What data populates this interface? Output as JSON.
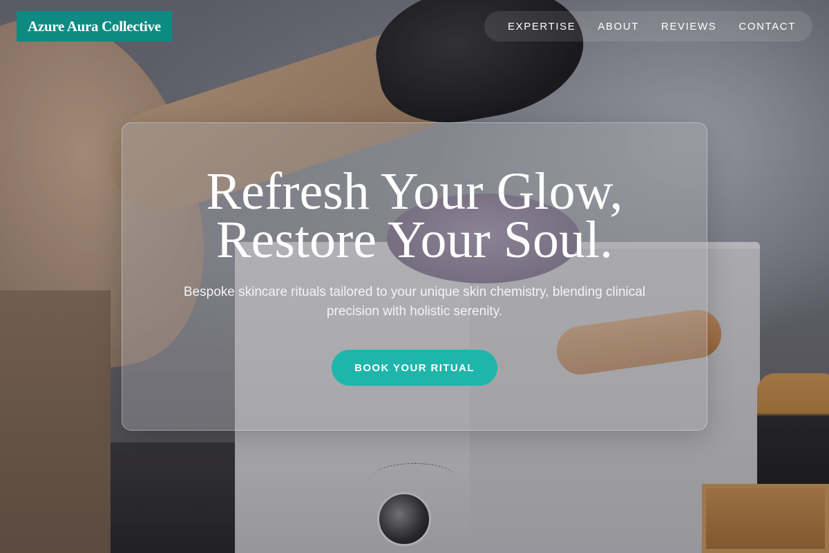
{
  "brand": {
    "name": "Azure Aura Collective"
  },
  "nav": {
    "items": [
      {
        "label": "EXPERTISE"
      },
      {
        "label": "ABOUT"
      },
      {
        "label": "REVIEWS"
      },
      {
        "label": "CONTACT"
      }
    ]
  },
  "hero": {
    "title_line1": "Refresh Your Glow,",
    "title_line2": "Restore Your Soul.",
    "subtitle": "Bespoke skincare rituals tailored to your unique skin chemistry, blending clinical precision with holistic serenity.",
    "cta_label": "BOOK YOUR RITUAL"
  },
  "colors": {
    "brand_background": "#0e8a82",
    "cta_background": "#1fb5aa",
    "text_primary": "#ffffff"
  }
}
